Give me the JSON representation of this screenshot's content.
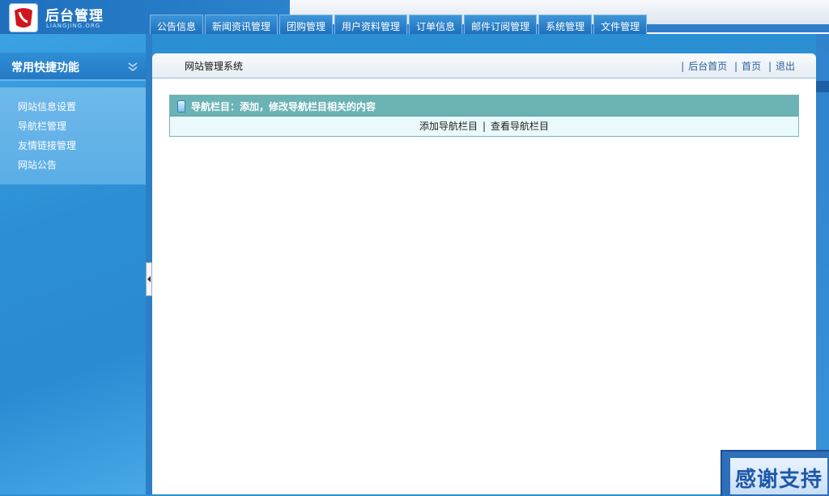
{
  "logo": {
    "title": "后台管理",
    "subtitle": "LIANGJING.ORG"
  },
  "top_tabs": [
    "公告信息",
    "新闻资讯管理",
    "团购管理",
    "用户资料管理",
    "订单信息",
    "邮件订阅管理",
    "系统管理",
    "文件管理"
  ],
  "sidebar": {
    "title": "常用快捷功能",
    "items": [
      "网站信息设置",
      "导航栏管理",
      "友情链接管理",
      "网站公告"
    ]
  },
  "main": {
    "site_title": "网站管理系统",
    "links": [
      "后台首页",
      "首页",
      "退出"
    ],
    "panel": {
      "title": "导航栏目：添加，修改导航栏目相关的内容",
      "actions": [
        "添加导航栏目",
        "查看导航栏目"
      ]
    }
  },
  "thanks_badge": "感谢支持",
  "colors": {
    "header": "#2c86d0",
    "panel_header": "#6bb3b5",
    "panel_body": "#eaf9fb",
    "link": "#2b5ea0"
  }
}
